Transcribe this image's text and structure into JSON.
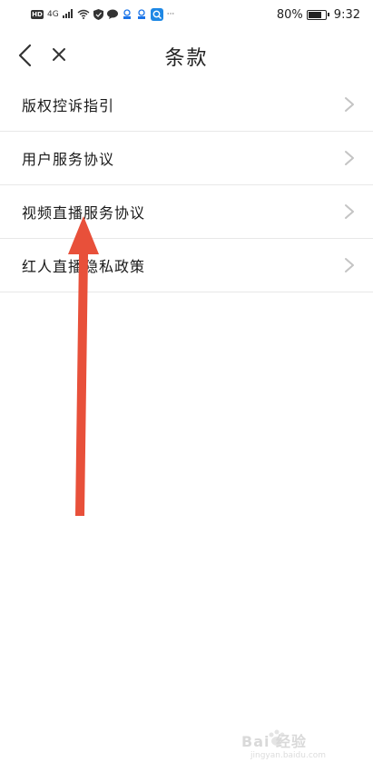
{
  "status_bar": {
    "hd_label": "HD",
    "network_label": "4G",
    "more_label": "···",
    "battery_percent": "80%",
    "battery_level": 0.8,
    "time": "9:32"
  },
  "header": {
    "title": "条款"
  },
  "terms": {
    "items": [
      {
        "label": "版权控诉指引"
      },
      {
        "label": "用户服务协议"
      },
      {
        "label": "视频直播服务协议"
      },
      {
        "label": "红人直播隐私政策"
      }
    ]
  },
  "annotation": {
    "color": "#e8503a",
    "target": "视频直播服务协议"
  },
  "watermark": {
    "text": "Bai 经验",
    "subtext": "jingyan.baidu.com"
  },
  "colors": {
    "divider": "#e8e8e8",
    "chevron": "#c4c4c4",
    "text_primary": "#1a1a1a"
  }
}
